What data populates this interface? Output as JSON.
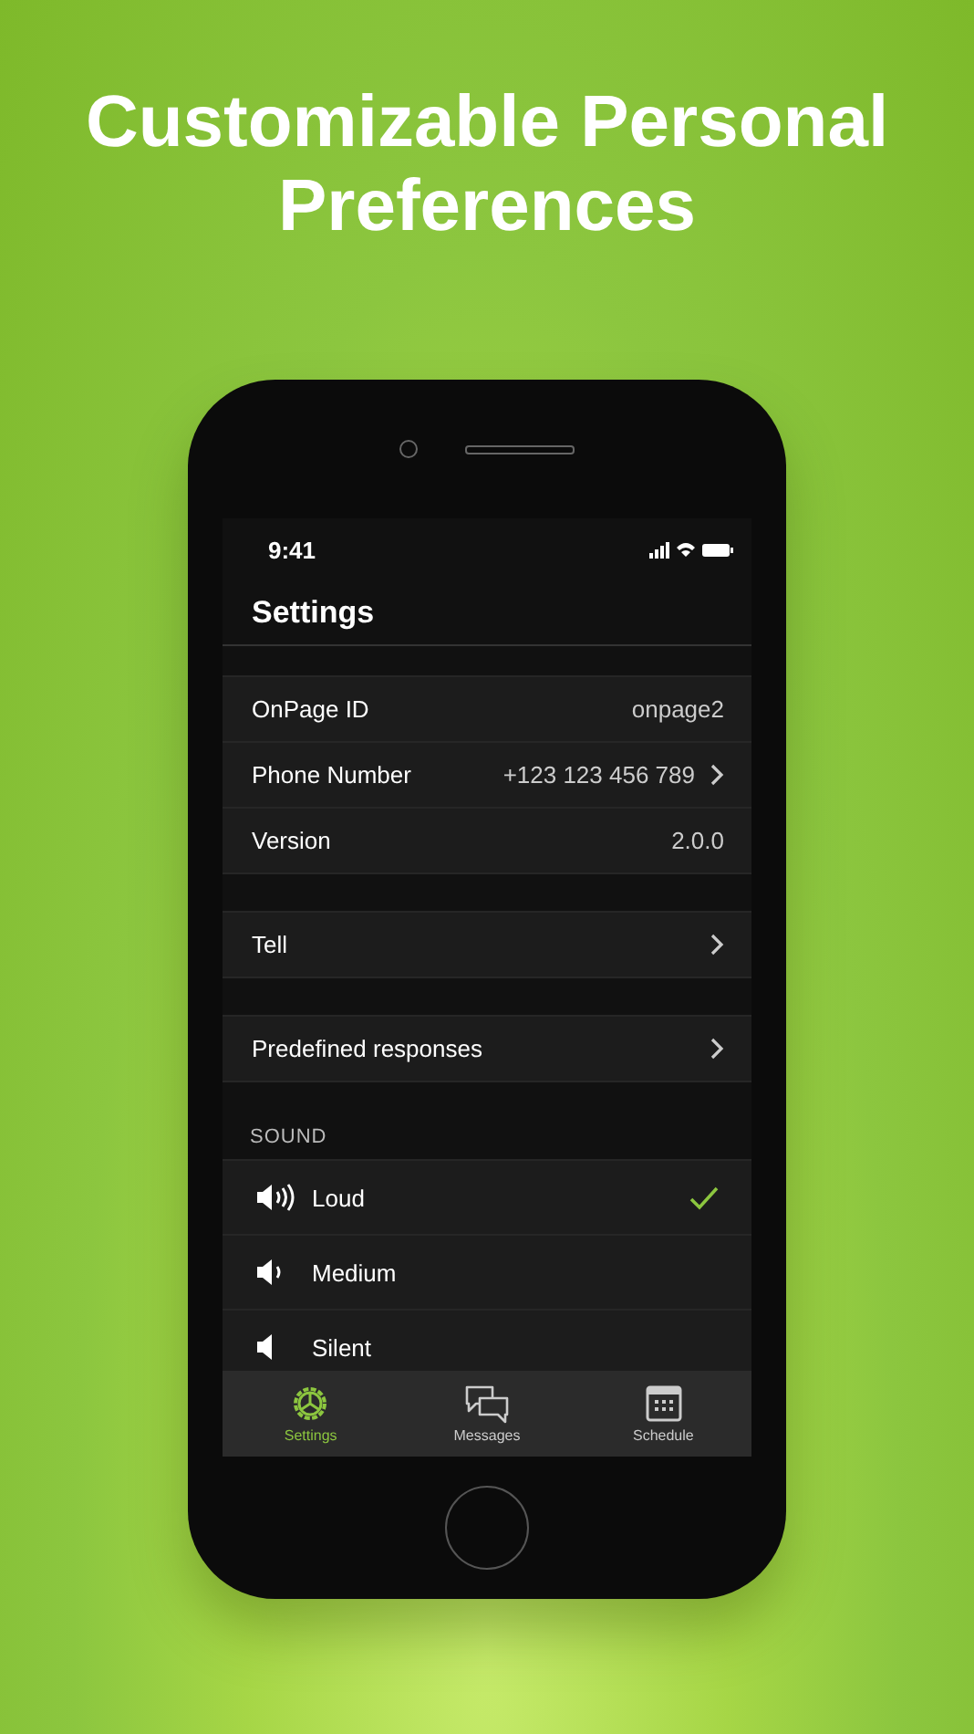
{
  "headline": "Customizable Personal Preferences",
  "status_bar": {
    "time": "9:41"
  },
  "screen_title": "Settings",
  "info_rows": [
    {
      "label": "OnPage ID",
      "value": "onpage2",
      "chevron": false
    },
    {
      "label": "Phone Number",
      "value": "+123 123 456 789",
      "chevron": true
    },
    {
      "label": "Version",
      "value": "2.0.0",
      "chevron": false
    }
  ],
  "link_rows": [
    {
      "label": "Tell"
    },
    {
      "label": "Predefined responses"
    }
  ],
  "sound": {
    "header": "SOUND",
    "options": [
      {
        "label": "Loud",
        "selected": true
      },
      {
        "label": "Medium",
        "selected": false
      },
      {
        "label": "Silent",
        "selected": false
      }
    ]
  },
  "tabs": [
    {
      "label": "Settings",
      "selected": true
    },
    {
      "label": "Messages",
      "selected": false
    },
    {
      "label": "Schedule",
      "selected": false
    }
  ]
}
